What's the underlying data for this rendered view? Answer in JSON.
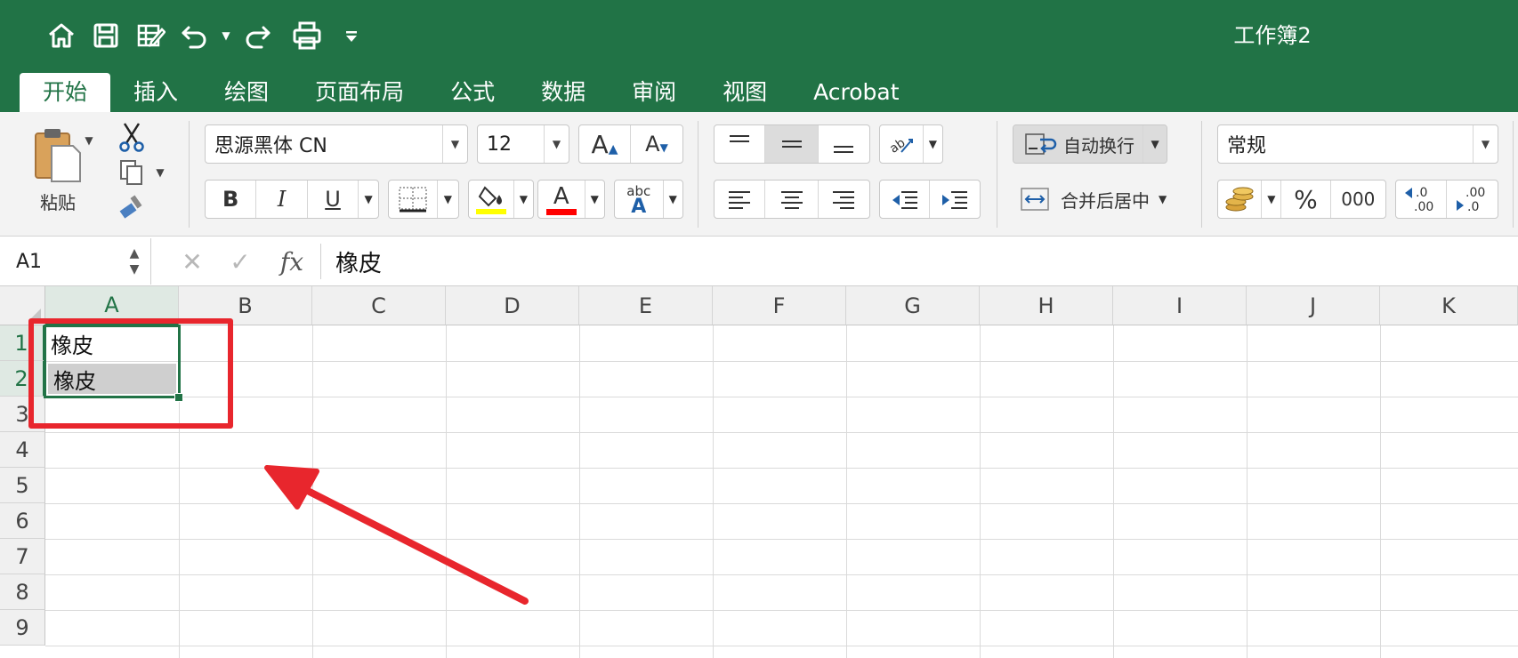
{
  "window": {
    "title": "工作簿2"
  },
  "tabs": [
    {
      "label": "开始",
      "active": true
    },
    {
      "label": "插入",
      "active": false
    },
    {
      "label": "绘图",
      "active": false
    },
    {
      "label": "页面布局",
      "active": false
    },
    {
      "label": "公式",
      "active": false
    },
    {
      "label": "数据",
      "active": false
    },
    {
      "label": "审阅",
      "active": false
    },
    {
      "label": "视图",
      "active": false
    },
    {
      "label": "Acrobat",
      "active": false
    }
  ],
  "ribbon": {
    "paste_label": "粘贴",
    "font_name": "思源黑体 CN",
    "font_size": "12",
    "wrap_text_label": "自动换行",
    "merge_center_label": "合并后居中",
    "number_format": "常规",
    "percent_label": "%",
    "thousands_label": "000",
    "bold_label": "B",
    "italic_label": "I",
    "underline_label": "U",
    "font_color_label": "A",
    "text_effects_top": "abc",
    "text_effects_bottom": "A",
    "fill_color": "#ffff00",
    "font_color": "#ff0000"
  },
  "formula_bar": {
    "name_box": "A1",
    "fx_label": "fx",
    "formula_value": "橡皮"
  },
  "grid": {
    "columns": [
      "A",
      "B",
      "C",
      "D",
      "E",
      "F",
      "G",
      "H",
      "I",
      "J",
      "K"
    ],
    "rows": [
      "1",
      "2",
      "3",
      "4",
      "5",
      "6",
      "7",
      "8",
      "9"
    ],
    "cells": {
      "A1": "橡皮",
      "A2": "橡皮"
    },
    "selected_range": "A1:A2",
    "active_cell": "A1"
  },
  "colors": {
    "excel_green": "#217346",
    "annotation_red": "#e8262d"
  }
}
